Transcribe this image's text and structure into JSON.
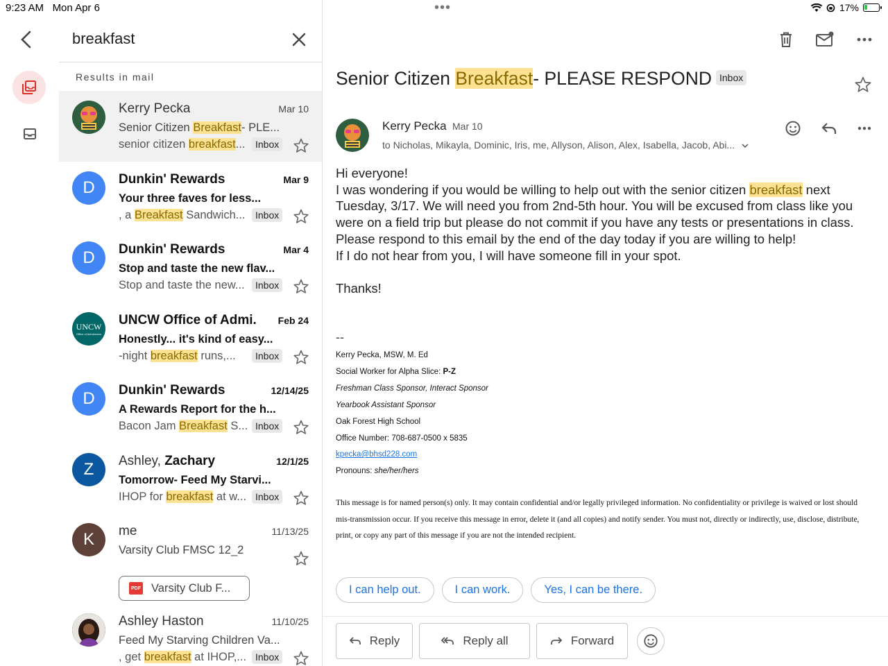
{
  "status": {
    "time": "9:23 AM",
    "date": "Mon Apr 6",
    "battery": "17%"
  },
  "search": {
    "query": "breakfast"
  },
  "results_label": "Results in mail",
  "colors": {
    "accent": "#1a73e8",
    "highlight": "#fde293",
    "rail_active": "#fce3e3"
  },
  "emails": [
    {
      "sender": "Kerry Pecka",
      "sender_bold": false,
      "date": "Mar 10",
      "date_bold": false,
      "subject_pre": "Senior Citizen ",
      "subject_hl": "Breakfast",
      "subject_post": "- PLE...",
      "subject_bold": false,
      "snippet_pre": "senior citizen ",
      "snippet_hl": "breakfast",
      "snippet_post": "...",
      "chip": "Inbox",
      "avatar": "tiger-mascot"
    },
    {
      "sender": "Dunkin' Rewards",
      "sender_bold": true,
      "date": "Mar 9",
      "date_bold": true,
      "subject_pre": "Your three faves for less...",
      "subject_hl": "",
      "subject_post": "",
      "subject_bold": true,
      "snippet_pre": ", a ",
      "snippet_hl": "Breakfast",
      "snippet_post": " Sandwich...",
      "chip": "Inbox",
      "avatar_letter": "D",
      "avatar_color": "#4285f4"
    },
    {
      "sender": "Dunkin' Rewards",
      "sender_bold": true,
      "date": "Mar 4",
      "date_bold": true,
      "subject_pre": "Stop and taste the new flav...",
      "subject_hl": "",
      "subject_post": "",
      "subject_bold": true,
      "snippet_pre": "Stop and taste the new...",
      "snippet_hl": "",
      "snippet_post": "",
      "chip": "Inbox",
      "avatar_letter": "D",
      "avatar_color": "#4285f4"
    },
    {
      "sender": "UNCW Office of Admi.",
      "sender_bold": true,
      "date": "Feb 24",
      "date_bold": true,
      "subject_pre": "Honestly... it's kind of easy...",
      "subject_hl": "",
      "subject_post": "",
      "subject_bold": true,
      "snippet_pre": "-night ",
      "snippet_hl": "breakfast",
      "snippet_post": " runs,...",
      "chip": "Inbox",
      "avatar_text": "UNCW",
      "avatar_subtext": "Office of Admissions",
      "avatar_color": "#006666"
    },
    {
      "sender": "Dunkin' Rewards",
      "sender_bold": true,
      "date": "12/14/25",
      "date_bold": true,
      "subject_pre": "A Rewards Report for the h...",
      "subject_hl": "",
      "subject_post": "",
      "subject_bold": true,
      "snippet_pre": "Bacon Jam ",
      "snippet_hl": "Breakfast",
      "snippet_post": " S...",
      "chip": "Inbox",
      "avatar_letter": "D",
      "avatar_color": "#4285f4"
    },
    {
      "sender": "Ashley, ",
      "sender_b2": "Zachary",
      "sender_bold": false,
      "date": "12/1/25",
      "date_bold": true,
      "subject_pre": "Tomorrow- Feed My Starvi...",
      "subject_hl": "",
      "subject_post": "",
      "subject_bold": true,
      "snippet_pre": "IHOP for ",
      "snippet_hl": "breakfast",
      "snippet_post": " at w...",
      "chip": "Inbox",
      "avatar_letter": "Z",
      "avatar_color": "#0b57a0"
    },
    {
      "sender": "me",
      "sender_bold": false,
      "date": "11/13/25",
      "date_bold": false,
      "subject_pre": "Varsity Club FMSC 12_2",
      "subject_hl": "",
      "subject_post": "",
      "subject_bold": false,
      "attachment": "Varsity Club F...",
      "attachment_type": "PDF",
      "avatar_letter": "K",
      "avatar_color": "#5d4037"
    },
    {
      "sender": "Ashley Haston",
      "sender_bold": false,
      "date": "11/10/25",
      "date_bold": false,
      "subject_pre": "Feed My Starving Children Va...",
      "subject_hl": "",
      "subject_post": "",
      "subject_bold": false,
      "snippet_pre": ", get ",
      "snippet_hl": "breakfast",
      "snippet_post": " at IHOP,...",
      "chip": "Inbox",
      "avatar": "photo"
    }
  ],
  "message": {
    "title_pre": "Senior Citizen ",
    "title_hl": "Breakfast",
    "title_post": "- PLEASE RESPOND",
    "label": "Inbox",
    "from": "Kerry Pecka",
    "date": "Mar 10",
    "to": "to Nicholas, Mikayla, Dominic, Iris, me, Allyson, Alison, Alex, Isabella, Jacob, Abi...",
    "greeting": "Hi everyone!",
    "p1_pre": "I was wondering if you would be willing to help out with the senior citizen ",
    "p1_hl": "breakfast",
    "p1_post": " next Tuesday, 3/17. We will need you from 2nd-5th hour. You will be excused from class like you were on a field trip but please do not commit if you have any tests or presentations in class.",
    "p2": "Please respond to this email by the end of the day today if you are willing to help!",
    "p3": "If I do not hear from you, I will have someone fill in your spot.",
    "thanks": "Thanks!",
    "sig_dash": "--",
    "sig_name": "Kerry Pecka, MSW, M. Ed",
    "sig_role_pre": "Social Worker for Alpha Slice: ",
    "sig_role_bold": "P-Z",
    "sig_sponsor1": "Freshman Class Sponsor, Interact Sponsor",
    "sig_sponsor2": "Yearbook Assistant Sponsor",
    "sig_school": "Oak Forest High School",
    "sig_phone": "Office Number: 708-687-0500 x 5835",
    "sig_email": "kpecka@bhsd228.com",
    "sig_pronouns_pre": "Pronouns: ",
    "sig_pronouns": "she/her/hers",
    "legal": "This message is for named person(s) only. It may contain confidential and/or legally privileged information. No confidentiality or privilege is waived or lost should mis-transmission occur. If you receive this message in error, delete it (and all copies) and notify sender. You must not, directly or indirectly, use, disclose, distribute, print, or copy any part of this message if you are not the intended recipient."
  },
  "smart_replies": [
    "I can help out.",
    "I can work.",
    "Yes, I can be there."
  ],
  "actions": {
    "reply": "Reply",
    "reply_all": "Reply all",
    "forward": "Forward"
  }
}
